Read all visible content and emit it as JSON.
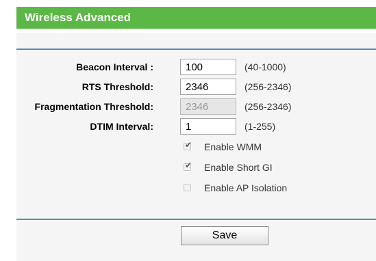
{
  "header": {
    "title": "Wireless Advanced"
  },
  "form": {
    "beacon_interval": {
      "label": "Beacon Interval :",
      "value": "100",
      "range": "(40-1000)"
    },
    "rts_threshold": {
      "label": "RTS Threshold:",
      "value": "2346",
      "range": "(256-2346)"
    },
    "fragmentation_threshold": {
      "label": "Fragmentation Threshold:",
      "value": "2346",
      "range": "(256-2346)",
      "disabled": true
    },
    "dtim_interval": {
      "label": "DTIM Interval:",
      "value": "1",
      "range": "(1-255)"
    },
    "checkboxes": [
      {
        "label": "Enable WMM",
        "checked": true
      },
      {
        "label": "Enable Short GI",
        "checked": true
      },
      {
        "label": "Enable AP Isolation",
        "checked": false
      }
    ]
  },
  "actions": {
    "save_label": "Save"
  },
  "colors": {
    "header_bg": "#5cb846",
    "rule": "#4a8fb0",
    "panel_bg": "#f5f5f5"
  }
}
